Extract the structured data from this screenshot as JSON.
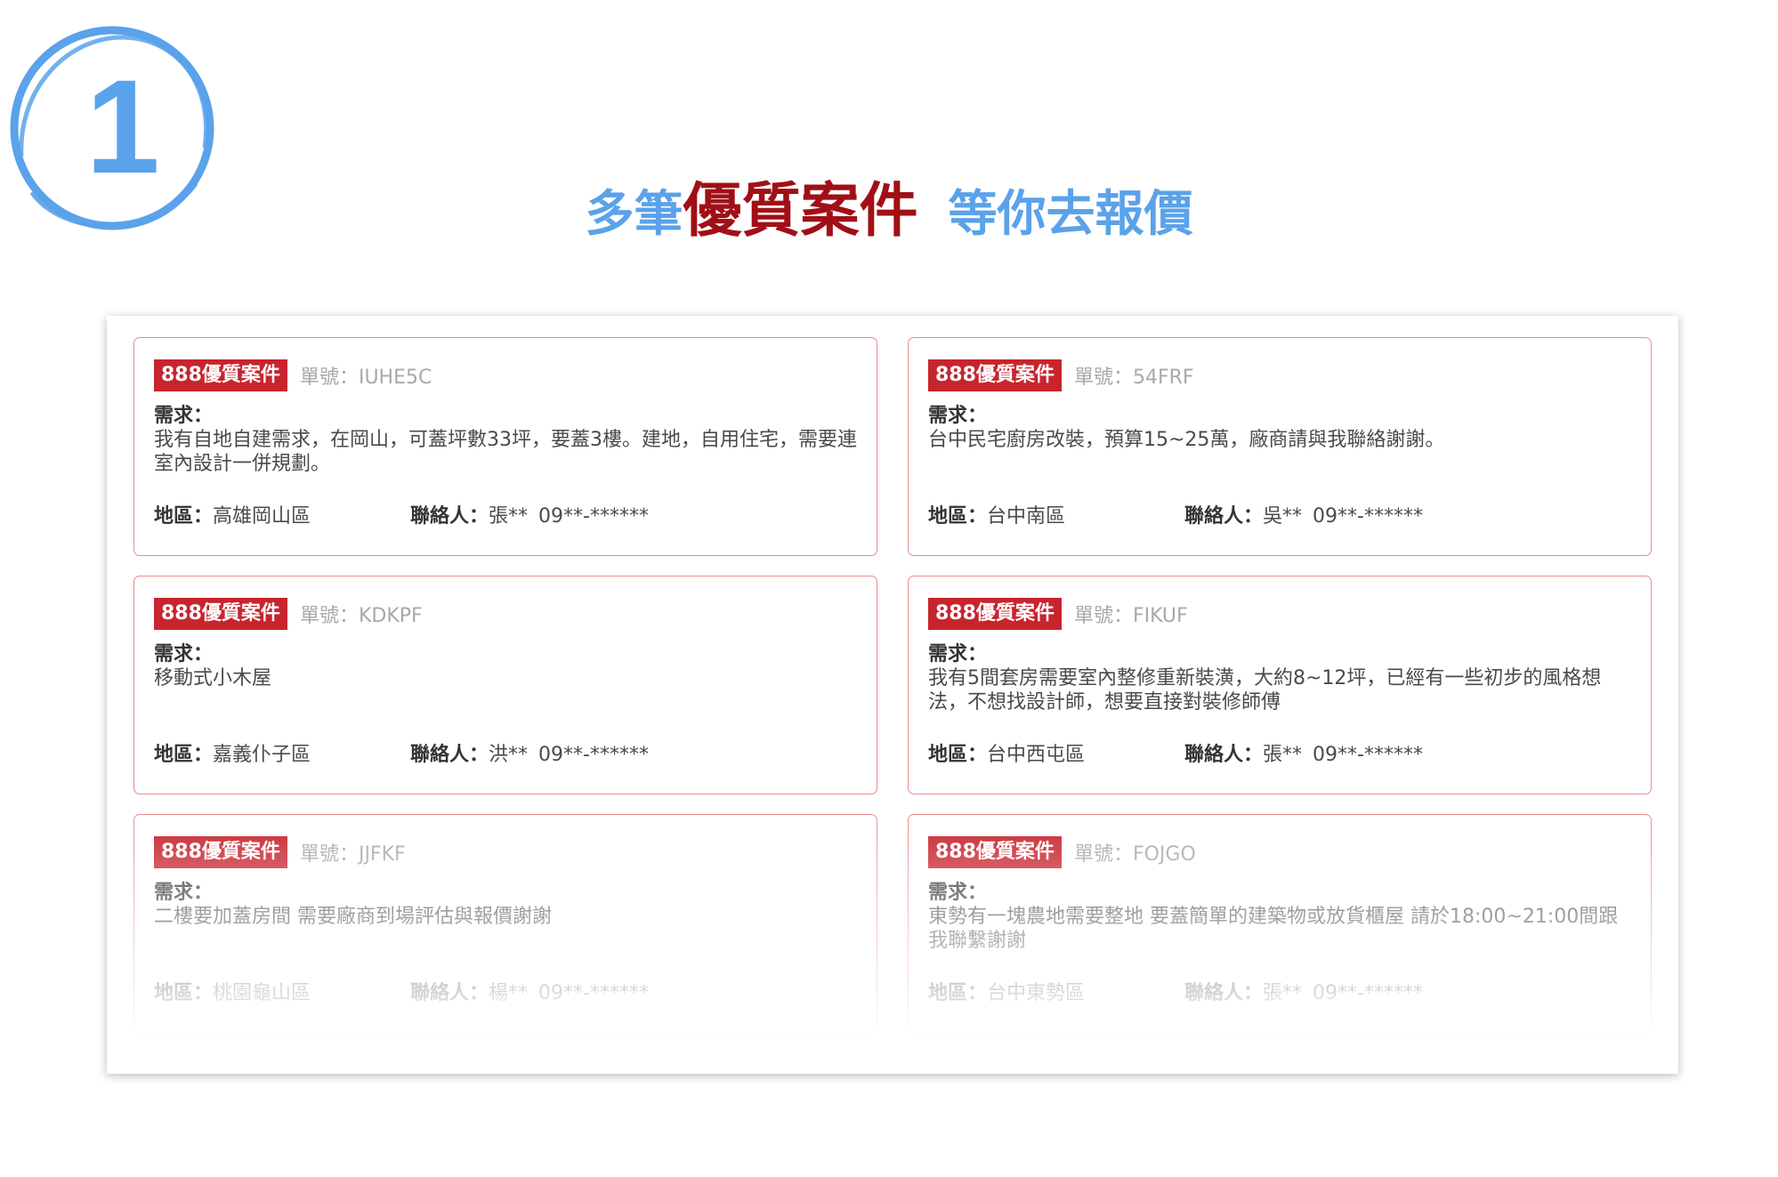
{
  "step": {
    "number": "1",
    "color": "#5aa2ea"
  },
  "headline": {
    "part1": "多筆",
    "part2": "優質案件",
    "part3": "等你去報價",
    "blue": "#5aa2ea",
    "red": "#a10f16"
  },
  "labels": {
    "order_prefix": "單號：",
    "requirement": "需求：",
    "region": "地區：",
    "contact": "聯絡人："
  },
  "accent": {
    "tag": "#c8242e",
    "border": "#ec8a8d"
  },
  "cases": [
    {
      "tag": "888優質案件",
      "order_id": "IUHE5C",
      "requirement": "我有自地自建需求，在岡山，可蓋坪數33坪，要蓋3樓。建地，自用住宅，需要連室內設計一併規劃。",
      "region": "高雄岡山區",
      "contact_name": "張**",
      "phone": "09**-******"
    },
    {
      "tag": "888優質案件",
      "order_id": "54FRF",
      "requirement": "台中民宅廚房改裝，預算15~25萬，廠商請與我聯絡謝謝。",
      "region": "台中南區",
      "contact_name": "吳**",
      "phone": "09**-******"
    },
    {
      "tag": "888優質案件",
      "order_id": "KDKPF",
      "requirement": "移動式小木屋",
      "region": "嘉義仆子區",
      "contact_name": "洪**",
      "phone": "09**-******"
    },
    {
      "tag": "888優質案件",
      "order_id": "FIKUF",
      "requirement": "我有5間套房需要室內整修重新裝潢，大約8~12坪，已經有一些初步的風格想法，不想找設計師，想要直接對裝修師傅",
      "region": "台中西屯區",
      "contact_name": "張**",
      "phone": "09**-******"
    },
    {
      "tag": "888優質案件",
      "order_id": "JJFKF",
      "requirement": "二樓要加蓋房間 需要廠商到場評估與報價謝謝",
      "region": "桃園龜山區",
      "contact_name": "楊**",
      "phone": "09**-******"
    },
    {
      "tag": "888優質案件",
      "order_id": "FOJGO",
      "requirement": "東勢有一塊農地需要整地 要蓋簡單的建築物或放貨櫃屋 請於18:00~21:00間跟我聯繫謝謝",
      "region": "台中東勢區",
      "contact_name": "張**",
      "phone": "09**-******"
    }
  ]
}
